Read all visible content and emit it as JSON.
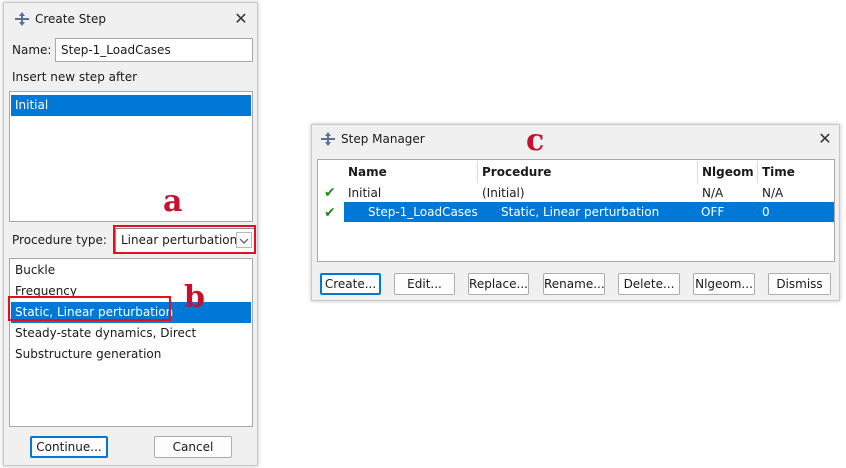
{
  "create_step": {
    "title": "Create Step",
    "close_glyph": "✕",
    "name_label": "Name:",
    "name_value": "Step-1_LoadCases",
    "insert_after_label": "Insert new step after",
    "insert_after_items": [
      "Initial"
    ],
    "procedure_type_label": "Procedure type:",
    "procedure_type_value": "Linear perturbation",
    "procedures": [
      "Buckle",
      "Frequency",
      "Static, Linear perturbation",
      "Steady-state dynamics, Direct",
      "Substructure generation"
    ],
    "selected_procedure_index": 2,
    "continue_label": "Continue...",
    "cancel_label": "Cancel"
  },
  "annotations": {
    "a": "a",
    "b": "b",
    "c": "c"
  },
  "step_manager": {
    "title": "Step Manager",
    "close_glyph": "✕",
    "columns": [
      "Name",
      "Procedure",
      "Nlgeom",
      "Time"
    ],
    "rows": [
      {
        "check": "✔",
        "name": "Initial",
        "procedure": "(Initial)",
        "nlgeom": "N/A",
        "time": "N/A"
      },
      {
        "check": "✔",
        "name": "Step-1_LoadCases",
        "procedure": "Static, Linear perturbation",
        "nlgeom": "OFF",
        "time": "0"
      }
    ],
    "selected_row_index": 1,
    "buttons": {
      "create": "Create...",
      "edit": "Edit...",
      "replace": "Replace...",
      "rename": "Rename...",
      "delete": "Delete...",
      "nlgeom": "Nlgeom...",
      "dismiss": "Dismiss"
    }
  },
  "colors": {
    "selection": "#0078d7",
    "annotation_red": "#c8102e",
    "highlight_box": "#e3101f",
    "check_green": "#2a8a1f"
  },
  "icons": {
    "app_icon": "abaqus-step-icon",
    "close": "close-icon",
    "dropdown": "chevron-down-icon",
    "status": "checkmark-icon"
  }
}
